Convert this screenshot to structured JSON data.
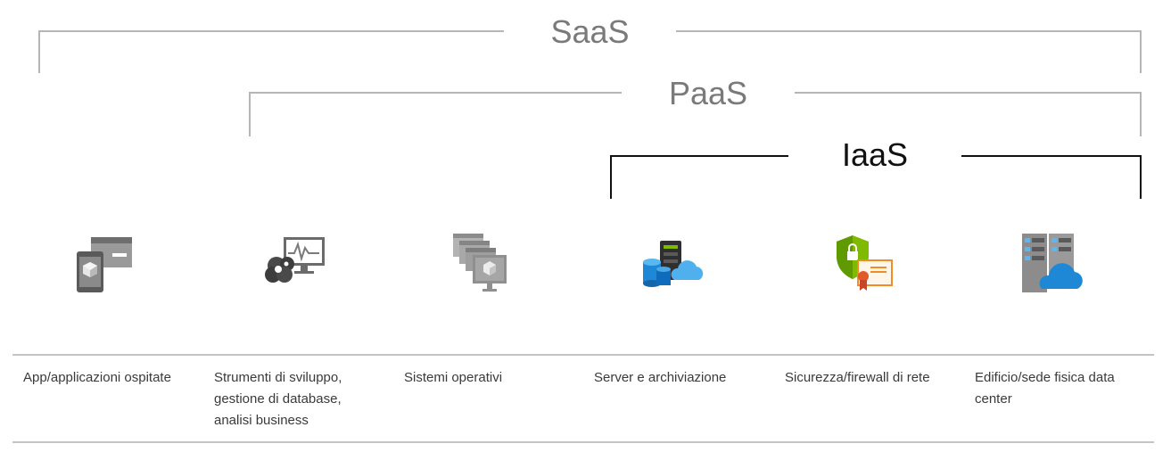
{
  "tiers": {
    "saas": "SaaS",
    "paas": "PaaS",
    "iaas": "IaaS"
  },
  "columns": [
    {
      "label": "App/applicazioni ospitate",
      "icon": "hosted-apps-icon"
    },
    {
      "label": "Strumenti di sviluppo, gestione di database, analisi business",
      "icon": "dev-tools-icon"
    },
    {
      "label": "Sistemi operativi",
      "icon": "operating-systems-icon"
    },
    {
      "label": "Server e archiviazione",
      "icon": "servers-storage-icon"
    },
    {
      "label": "Sicurezza/firewall di rete",
      "icon": "security-firewall-icon"
    },
    {
      "label": "Edificio/sede fisica data center",
      "icon": "datacenter-building-icon"
    }
  ],
  "colors": {
    "gray_line": "#b5b5b5",
    "iaas_line": "#111111",
    "icon_gray": "#7d7d7d",
    "azure_blue": "#1e88d6",
    "shield_green": "#7fba00",
    "cert_orange": "#f28c28"
  }
}
